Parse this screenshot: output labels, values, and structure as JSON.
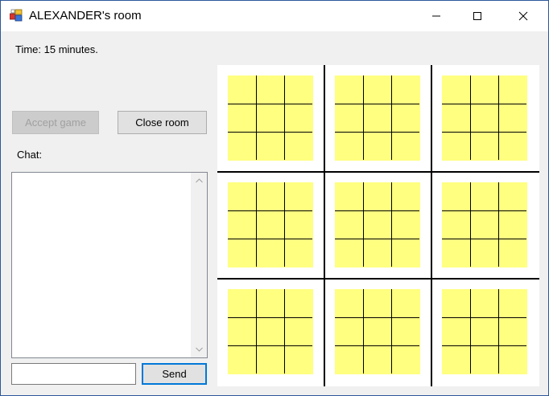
{
  "window": {
    "title": "ALEXANDER's room",
    "icon": "app-icon"
  },
  "status": {
    "time_text": "Time: 15 minutes."
  },
  "buttons": {
    "accept_game": "Accept game",
    "accept_game_enabled": false,
    "close_room": "Close room",
    "send": "Send"
  },
  "chat": {
    "label": "Chat:",
    "messages": [],
    "input_value": "",
    "input_placeholder": ""
  },
  "board": {
    "layout": "3x3 big board of 3x3 small boards",
    "small_board_color": "#ffff80",
    "line_color": "#000000",
    "boards": [
      [
        "",
        "",
        "",
        "",
        "",
        "",
        "",
        "",
        ""
      ],
      [
        "",
        "",
        "",
        "",
        "",
        "",
        "",
        "",
        ""
      ],
      [
        "",
        "",
        "",
        "",
        "",
        "",
        "",
        "",
        ""
      ],
      [
        "",
        "",
        "",
        "",
        "",
        "",
        "",
        "",
        ""
      ],
      [
        "",
        "",
        "",
        "",
        "",
        "",
        "",
        "",
        ""
      ],
      [
        "",
        "",
        "",
        "",
        "",
        "",
        "",
        "",
        ""
      ],
      [
        "",
        "",
        "",
        "",
        "",
        "",
        "",
        "",
        ""
      ],
      [
        "",
        "",
        "",
        "",
        "",
        "",
        "",
        "",
        ""
      ],
      [
        "",
        "",
        "",
        "",
        "",
        "",
        "",
        "",
        ""
      ]
    ]
  }
}
